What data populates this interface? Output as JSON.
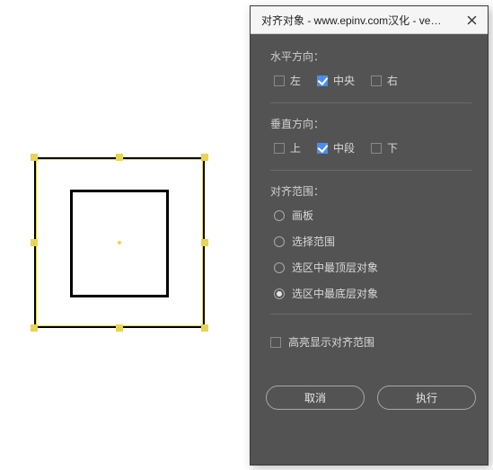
{
  "dialog": {
    "title": "对齐对象 - www.epinv.com汉化 - ve…",
    "horizontal": {
      "label": "水平方向：",
      "options": {
        "left": "左",
        "center": "中央",
        "right": "右"
      },
      "checked": "center"
    },
    "vertical": {
      "label": "垂直方向：",
      "options": {
        "top": "上",
        "middle": "中段",
        "bottom": "下"
      },
      "checked": "middle"
    },
    "scope": {
      "label": "对齐范围：",
      "options": {
        "artboard": "画板",
        "selection": "选择范围",
        "topmost": "选区中最顶层对象",
        "bottommost": "选区中最底层对象"
      },
      "selected": "bottommost"
    },
    "highlight": {
      "label": "高亮显示对齐范围",
      "checked": false
    },
    "buttons": {
      "cancel": "取消",
      "execute": "执行"
    }
  }
}
